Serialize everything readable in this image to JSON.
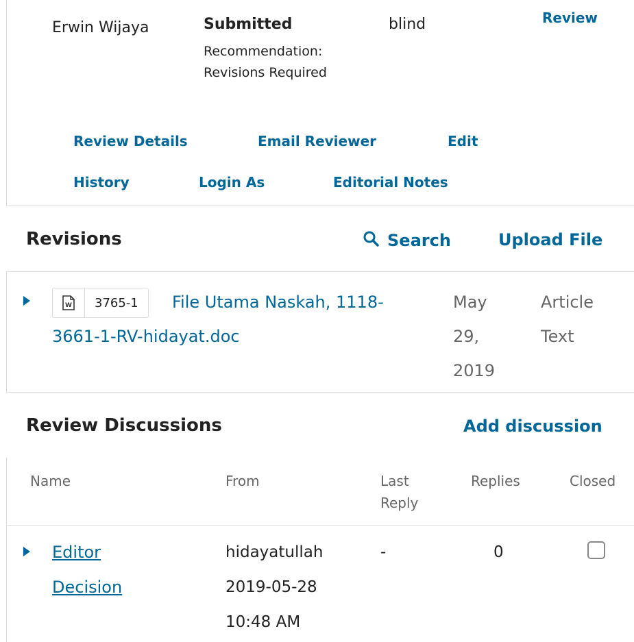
{
  "reviewer": {
    "name": "Erwin Wijaya",
    "status": "Submitted",
    "recommendation": "Recommendation: Revisions Required",
    "method": "blind",
    "review_link": "Review"
  },
  "reviewer_actions": {
    "review_details": "Review Details",
    "email_reviewer": "Email Reviewer",
    "edit": "Edit",
    "history": "History",
    "login_as": "Login As",
    "editorial_notes": "Editorial Notes"
  },
  "revisions": {
    "title": "Revisions",
    "search_label": "Search",
    "upload_label": "Upload File",
    "files": [
      {
        "file_id": "3765-1",
        "file_type_icon": "word-doc-icon",
        "name": "File Utama Naskah, 1118-3661-1-RV-hidayat.doc",
        "date": "May 29, 2019",
        "component": "Article Text"
      }
    ]
  },
  "discussions": {
    "title": "Review Discussions",
    "add_label": "Add discussion",
    "columns": [
      "Name",
      "From",
      "Last Reply",
      "Replies",
      "Closed"
    ],
    "rows": [
      {
        "name": "Editor Decision",
        "from": "hidayatullah 2019-05-28 10:48 AM",
        "last_reply": "-",
        "replies": "0",
        "closed": false
      }
    ]
  },
  "colors": {
    "link": "#006798",
    "text": "#222222",
    "muted": "#666666",
    "border": "#dddddd"
  }
}
